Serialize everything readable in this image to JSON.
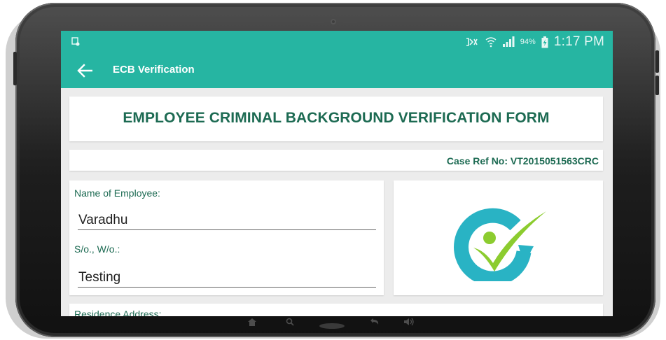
{
  "status_bar": {
    "battery_percent": "94%",
    "time": "1:17 PM",
    "icons": [
      "screenshot-icon",
      "mute-icon",
      "wifi-icon",
      "signal-icon",
      "battery-charging-icon"
    ]
  },
  "app_bar": {
    "title": "ECB Verification",
    "back_icon": "arrow-left-icon"
  },
  "form": {
    "title": "EMPLOYEE CRIMINAL BACKGROUND VERIFICATION FORM",
    "case_ref": "Case Ref No: VT2015051563CRC",
    "name_label": "Name of Employee:",
    "name_value": "Varadhu",
    "relation_label": "S/o., W/o.:",
    "relation_value": "Testing",
    "address_label": "Residence Address:"
  },
  "logo": {
    "icon": "check-circle-logo"
  },
  "nav_icons": [
    "home-icon",
    "search-icon",
    "back-icon",
    "volume-icon"
  ],
  "colors": {
    "primary": "#26b5a2",
    "heading_text": "#1c6a52",
    "logo_teal": "#29b3c4",
    "logo_green": "#8ccc2f"
  }
}
